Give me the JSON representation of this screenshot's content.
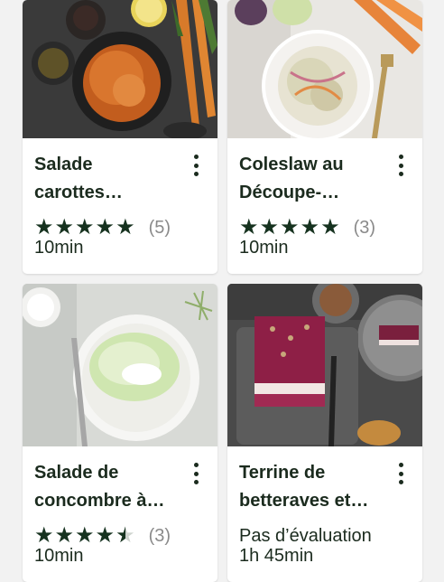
{
  "recipes": [
    {
      "title": "Salade\ncarottes…",
      "stars": [
        1,
        1,
        1,
        1,
        1
      ],
      "count": "(5)",
      "time": "10min",
      "rating_value": 5
    },
    {
      "title": "Coleslaw au\nDécoupe-…",
      "stars": [
        1,
        1,
        1,
        1,
        1
      ],
      "count": "(3)",
      "time": "10min",
      "rating_value": 5
    },
    {
      "title": "Salade de\nconcombre à…",
      "stars": [
        1,
        1,
        1,
        1,
        0.5
      ],
      "count": "(3)",
      "time": "10min",
      "rating_value": 4.5
    },
    {
      "title": "Terrine de\nbetteraves et…",
      "no_rating": "Pas d’évaluation",
      "time": "1h 45min"
    }
  ],
  "icons": {
    "menu": "more-vert-icon",
    "star": "star-icon"
  },
  "colors": {
    "accent": "#16321f",
    "text": "#1b2b1e",
    "muted": "#8a8a8a",
    "background": "#f2f2f2"
  }
}
